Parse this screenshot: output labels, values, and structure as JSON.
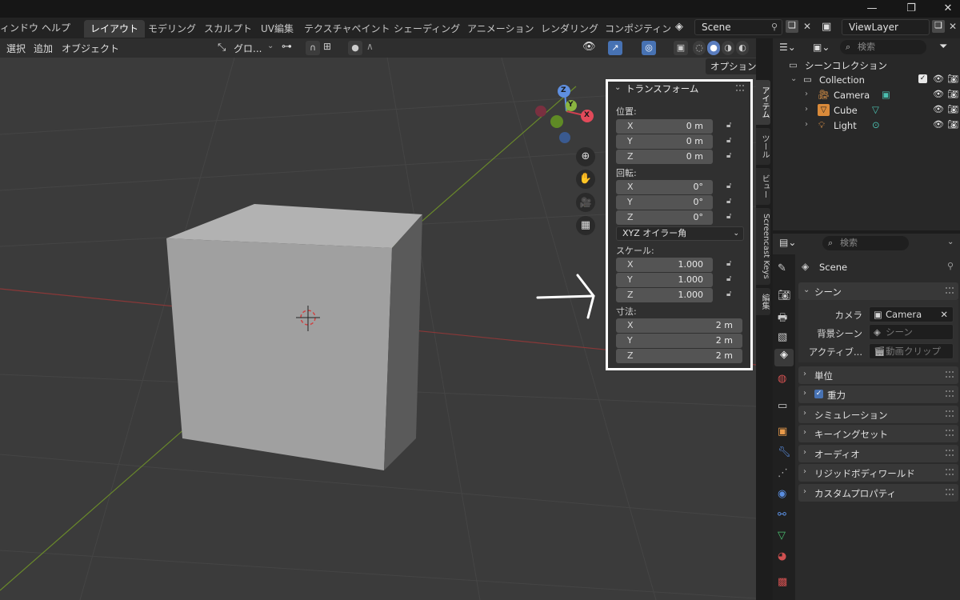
{
  "menu": {
    "window": "ィンドウ",
    "help": "ヘルプ"
  },
  "workspaces": [
    "レイアウト",
    "モデリング",
    "スカルプト",
    "UV編集",
    "テクスチャペイント",
    "シェーディング",
    "アニメーション",
    "レンダリング",
    "コンポジティン:"
  ],
  "scene_field": "Scene",
  "viewlayer_field": "ViewLayer",
  "viewport": {
    "menus": [
      "選択",
      "追加",
      "オブジェクト"
    ],
    "transform_orientation": "グロ...",
    "options_label": "オプション",
    "gizmo": {
      "x": "X",
      "y": "Y",
      "z": "Z"
    }
  },
  "npanel": {
    "title": "トランスフォーム",
    "location_label": "位置:",
    "location": [
      {
        "axis": "X",
        "value": "0 m"
      },
      {
        "axis": "Y",
        "value": "0 m"
      },
      {
        "axis": "Z",
        "value": "0 m"
      }
    ],
    "rotation_label": "回転:",
    "rotation": [
      {
        "axis": "X",
        "value": "0°"
      },
      {
        "axis": "Y",
        "value": "0°"
      },
      {
        "axis": "Z",
        "value": "0°"
      }
    ],
    "rotation_mode": "XYZ オイラー角",
    "scale_label": "スケール:",
    "scale": [
      {
        "axis": "X",
        "value": "1.000"
      },
      {
        "axis": "Y",
        "value": "1.000"
      },
      {
        "axis": "Z",
        "value": "1.000"
      }
    ],
    "dimensions_label": "寸法:",
    "dimensions": [
      {
        "axis": "X",
        "value": "2 m"
      },
      {
        "axis": "Y",
        "value": "2 m"
      },
      {
        "axis": "Z",
        "value": "2 m"
      }
    ]
  },
  "side_tabs": [
    "アイテム",
    "ツール",
    "ビュー",
    "Screencast Keys",
    "編集"
  ],
  "outliner": {
    "search_placeholder": "検索",
    "scene_collection": "シーンコレクション",
    "collection": "Collection",
    "items": [
      "Camera",
      "Cube",
      "Light"
    ]
  },
  "properties": {
    "search_placeholder": "検索",
    "context": "Scene",
    "scene_section": "シーン",
    "camera_label": "カメラ",
    "camera_value": "Camera",
    "bg_scene_label": "背景シーン",
    "bg_scene_placeholder": "シーン",
    "active_clip_label": "アクティブ...",
    "active_clip_placeholder": "動画クリップ",
    "sections": [
      "単位",
      "重力",
      "シミュレーション",
      "キーイングセット",
      "オーディオ",
      "リジッドボディワールド",
      "カスタムプロパティ"
    ]
  },
  "colors": {
    "accent": "#4772b3",
    "highlight_border": "#ffffff"
  }
}
